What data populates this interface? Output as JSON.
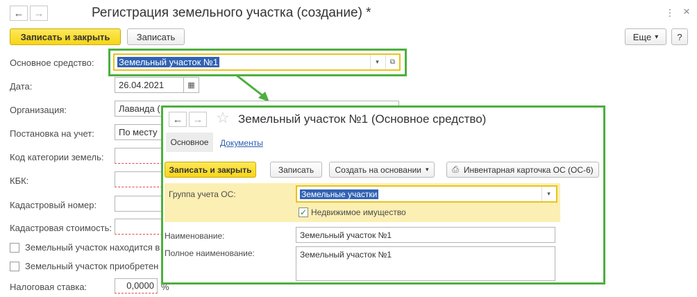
{
  "window": {
    "title": "Регистрация земельного участка (создание) *",
    "back_icon": "←",
    "forward_icon": "→",
    "more_icon": "⋮",
    "close_icon": "×"
  },
  "toolbar": {
    "save_close": "Записать и закрыть",
    "save": "Записать",
    "more": "Еще",
    "more_arrow": "▾",
    "help": "?"
  },
  "form": {
    "fixed_asset": {
      "label": "Основное средство:",
      "value": "Земельный участок №1"
    },
    "date": {
      "label": "Дата:",
      "value": "26.04.2021"
    },
    "organization": {
      "label": "Организация:",
      "value": "Лаванда ("
    },
    "registration": {
      "label": "Постановка на учет:",
      "value": "По месту"
    },
    "land_category": {
      "label": "Код категории земель:"
    },
    "kbk": {
      "label": "КБК:"
    },
    "cadastral_number": {
      "label": "Кадастровый номер:"
    },
    "cadastral_value": {
      "label": "Кадастровая стоимость:"
    },
    "check1": {
      "label": "Земельный участок находится в"
    },
    "check2": {
      "label": "Земельный участок приобретен"
    },
    "tax_rate": {
      "label": "Налоговая ставка:",
      "value": "0,0000",
      "unit": "%"
    }
  },
  "overlay": {
    "title": "Земельный участок №1 (Основное средство)",
    "tabs": [
      "Основное",
      "Документы"
    ],
    "buttons": {
      "save_close": "Записать и закрыть",
      "save": "Записать",
      "create_based": "Создать на основании",
      "inventory_card": "Инвентарная карточка ОС (ОС-6)"
    },
    "group": {
      "label": "Группа учета ОС:",
      "value": "Земельные участки"
    },
    "real_estate": {
      "label": "Недвижимое имущество",
      "checked": true
    },
    "name": {
      "label": "Наименование:",
      "value": "Земельный участок №1"
    },
    "full_name": {
      "label": "Полное наименование:",
      "value": "Земельный участок №1"
    }
  },
  "colors": {
    "accent_yellow": "#f7d516",
    "highlight_green": "#4daf3e",
    "selection_blue": "#3163b4",
    "group_bg": "#fcefb3"
  }
}
